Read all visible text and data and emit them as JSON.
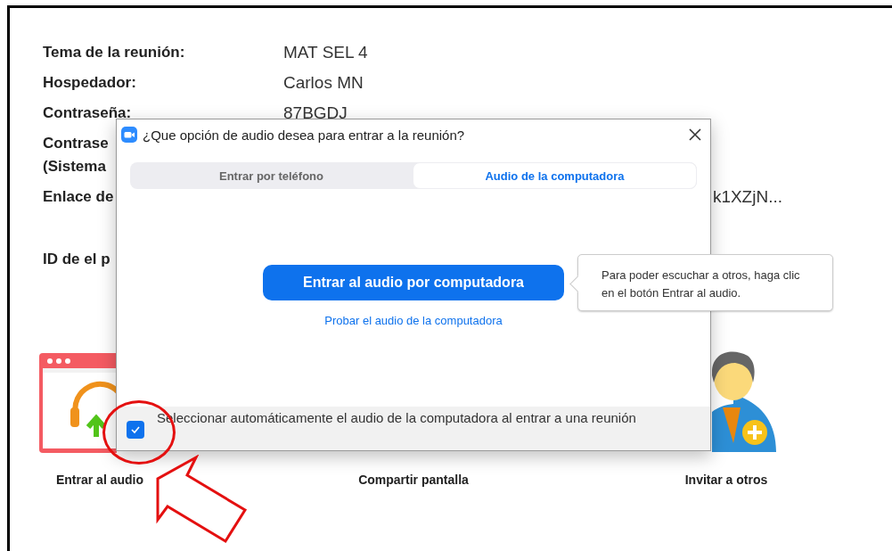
{
  "meeting_info": [
    {
      "label_lines": [
        "Tema de la reunión:"
      ],
      "value": "MAT SEL 4"
    },
    {
      "label_lines": [
        "Hospedador:"
      ],
      "value": "Carlos MN"
    },
    {
      "label_lines": [
        "Contraseña:"
      ],
      "value": "87BGDJ"
    },
    {
      "label_lines": [
        "Contrase",
        "(Sistema"
      ]
    },
    {
      "label_lines": [
        "Enlace de"
      ],
      "value": "k1XZjN...",
      "truncated_start": true
    },
    {
      "label_lines": [
        "ID de el p"
      ]
    }
  ],
  "actions": [
    {
      "label": "Entrar al audio",
      "kind": "headphones"
    },
    {
      "label": "Compartir pantalla",
      "kind": "hidden"
    },
    {
      "label": "Invitar a otros",
      "kind": "person"
    }
  ],
  "dialog": {
    "title": "¿Que opción de audio desea para entrar a la reunión?",
    "tabs": [
      {
        "label": "Entrar por teléfono",
        "selected": false
      },
      {
        "label": "Audio de la computadora",
        "selected": true
      }
    ],
    "primary_button": "Entrar al audio por computadora",
    "link": "Probar el audio de la computadora",
    "checkbox": {
      "label": "Seleccionar automáticamente el audio de la computadora al entrar a una reunión",
      "checked": true
    }
  },
  "tooltip": "Para poder escuchar a otros, haga clic en el botón Entrar al audio."
}
